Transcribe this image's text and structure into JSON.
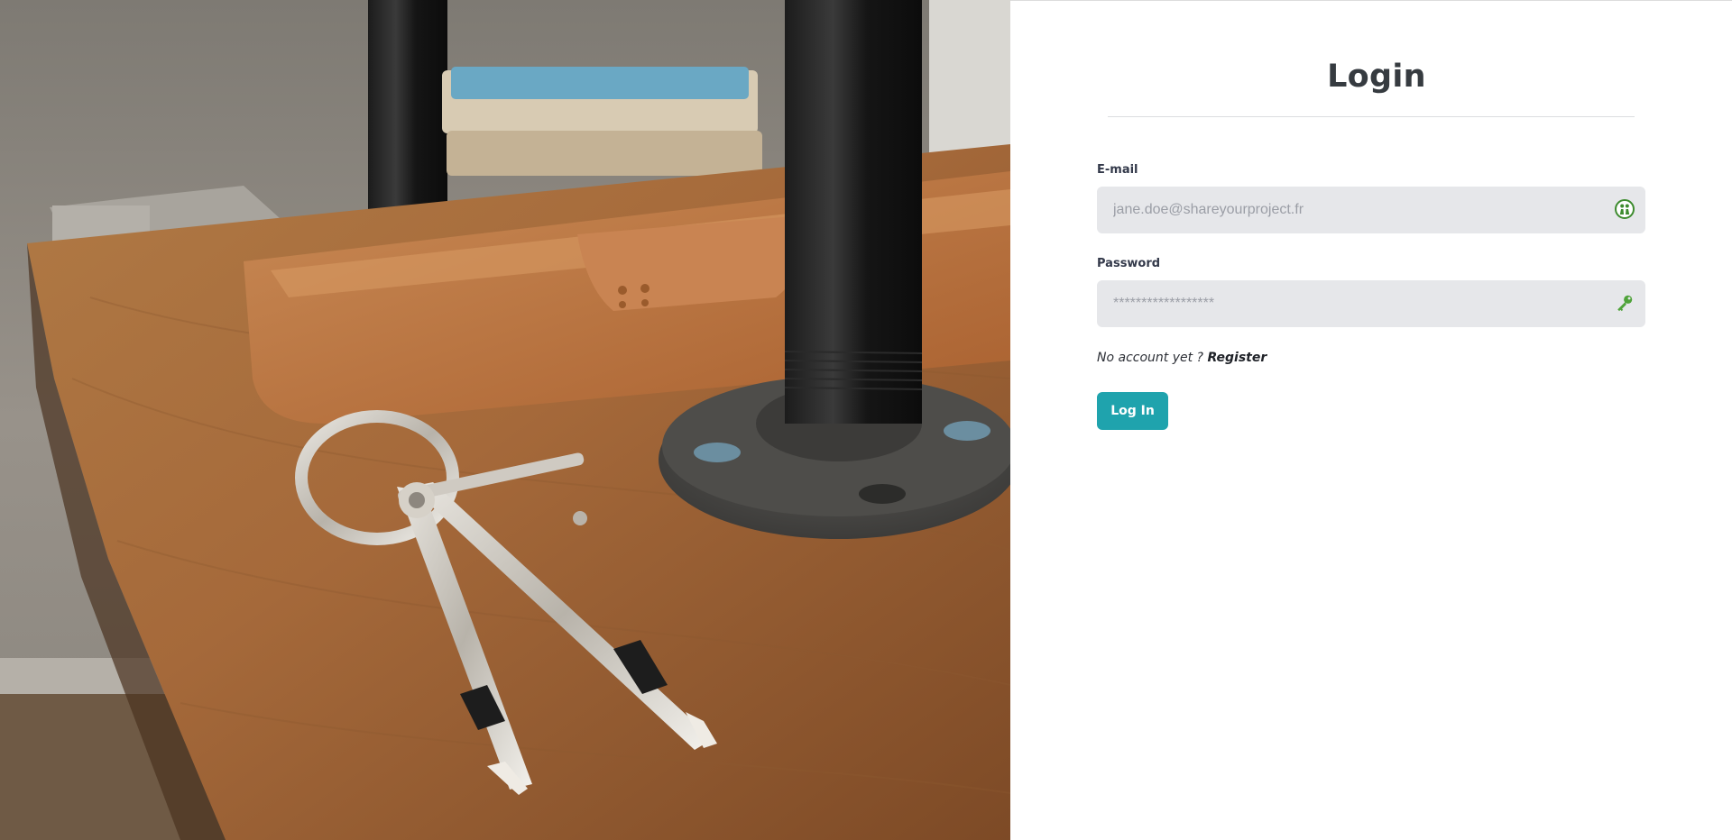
{
  "form": {
    "title": "Login",
    "email": {
      "label": "E-mail",
      "placeholder": "jane.doe@shareyourproject.fr",
      "value": "",
      "icon": "user-icon"
    },
    "password": {
      "label": "Password",
      "placeholder": "******************",
      "value": "",
      "icon": "key-icon"
    },
    "register_prompt": "No account yet ?",
    "register_link": "Register",
    "submit_label": "Log In"
  },
  "colors": {
    "accent": "#1fa3ad",
    "input_bg": "#e6e7ea",
    "icon_green": "#3d8b2e"
  },
  "hero_image": {
    "icon": "desk-photo"
  }
}
